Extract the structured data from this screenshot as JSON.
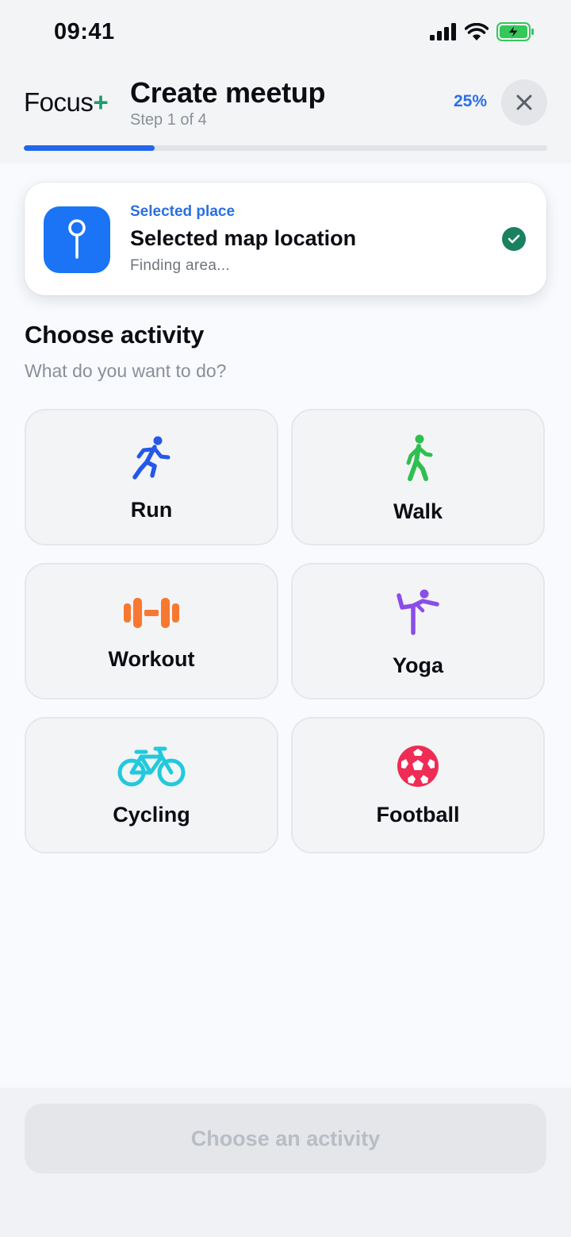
{
  "status_bar": {
    "time": "09:41"
  },
  "header": {
    "brand": "Focus",
    "brand_plus": "+",
    "title": "Create meetup",
    "step": "Step 1 of 4",
    "progress_label": "25%",
    "progress_fraction": 0.25
  },
  "place": {
    "kicker": "Selected place",
    "title": "Selected map location",
    "subtitle": "Finding area..."
  },
  "activity": {
    "title": "Choose activity",
    "subtitle": "What do you want to do?",
    "options": [
      {
        "label": "Run",
        "icon": "running-icon",
        "color": "#2558e8"
      },
      {
        "label": "Walk",
        "icon": "walking-icon",
        "color": "#2fbf4f"
      },
      {
        "label": "Workout",
        "icon": "dumbbell-icon",
        "color": "#f7782f"
      },
      {
        "label": "Yoga",
        "icon": "yoga-icon",
        "color": "#8a4de8"
      },
      {
        "label": "Cycling",
        "icon": "bicycle-icon",
        "color": "#22c9dc"
      },
      {
        "label": "Football",
        "icon": "football-icon",
        "color": "#ef2c55"
      }
    ]
  },
  "footer": {
    "cta_label": "Choose an activity"
  },
  "colors": {
    "accent": "#2466ea",
    "brand_green": "#1f9b6e",
    "success": "#1a8060"
  }
}
